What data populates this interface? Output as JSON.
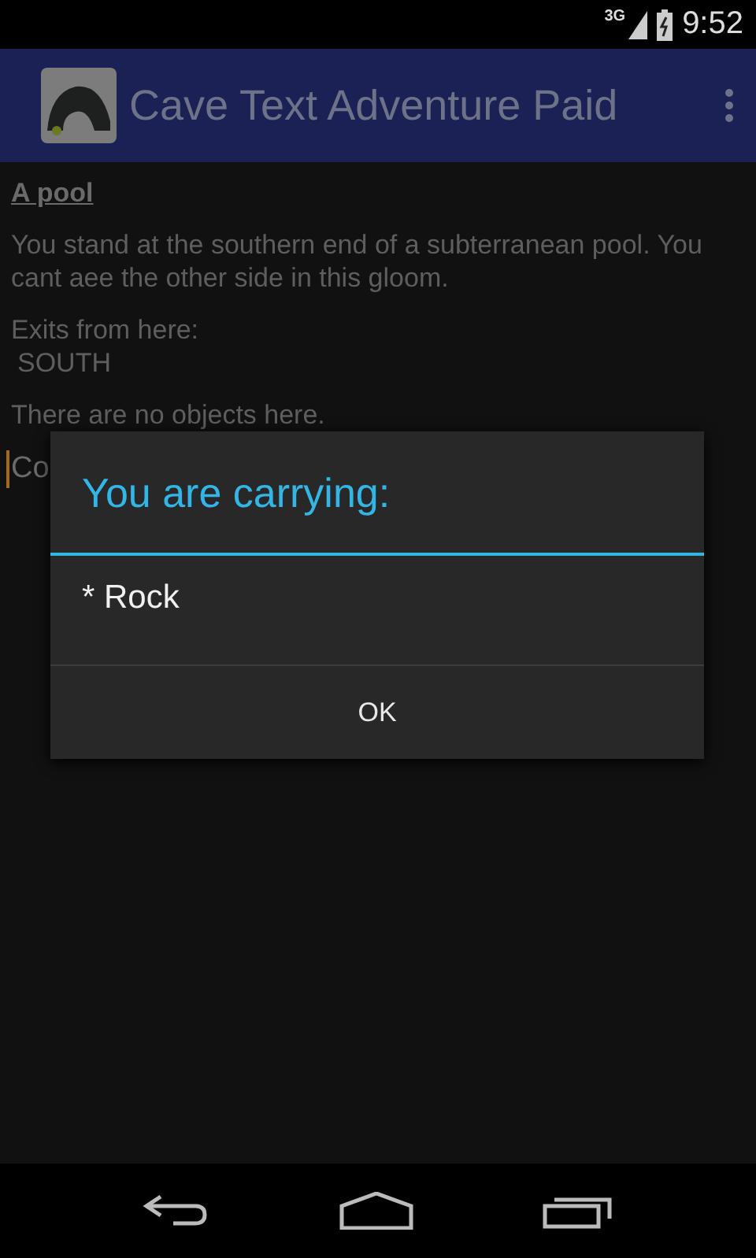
{
  "status_bar": {
    "network": "3G",
    "time": "9:52"
  },
  "action_bar": {
    "title": "Cave Text Adventure Paid"
  },
  "content": {
    "room_title": "A pool",
    "description": "You stand at the southern end of a subterranean pool. You cant aee the other side in this gloom.",
    "exits_label": "Exits from here:",
    "exits": [
      "SOUTH"
    ],
    "objects": "There are no objects here.",
    "command": {
      "value": "Co"
    }
  },
  "dialog": {
    "title": "You are carrying:",
    "items": [
      "* Rock"
    ],
    "buttons": [
      "OK"
    ]
  }
}
